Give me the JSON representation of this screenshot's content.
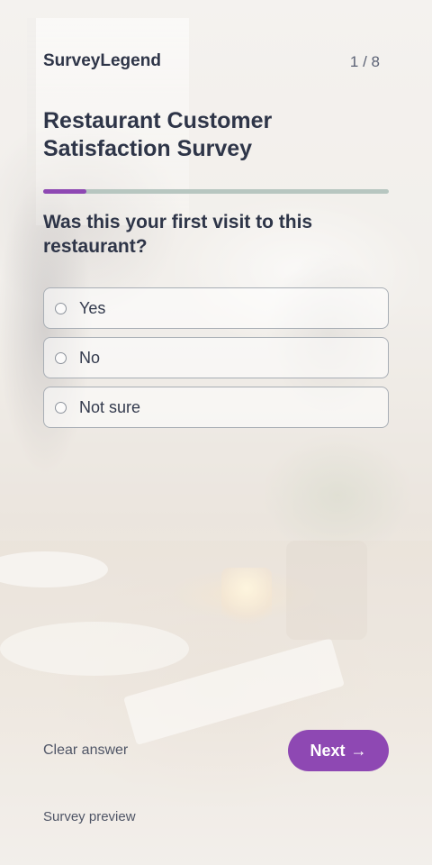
{
  "header": {
    "brand": "SurveyLegend",
    "page_counter": "1 / 8"
  },
  "survey": {
    "title": "Restaurant Customer Satisfaction Survey",
    "progress": 0.125,
    "colors": {
      "accent": "#8e48b3",
      "progress_track": "#b7c6c0"
    }
  },
  "question": {
    "text": "Was this your first visit to this restaurant?",
    "options": [
      {
        "label": "Yes",
        "selected": false
      },
      {
        "label": "No",
        "selected": false
      },
      {
        "label": "Not sure",
        "selected": false
      }
    ]
  },
  "actions": {
    "clear_label": "Clear answer",
    "next_label": "Next",
    "next_icon": "arrow-right-icon",
    "next_glyph": "→"
  },
  "footer": {
    "text": "Survey preview"
  }
}
